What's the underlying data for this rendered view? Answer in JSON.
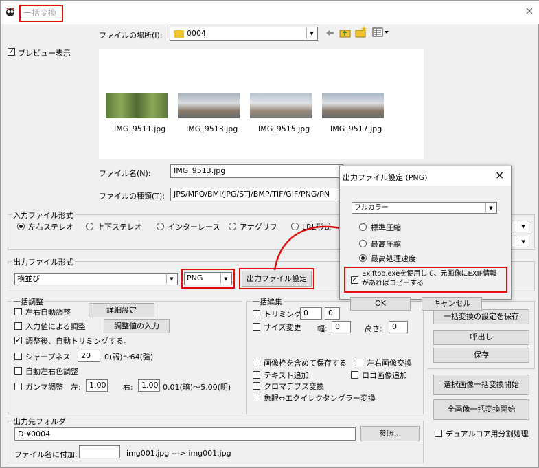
{
  "window": {
    "title": "一括変換",
    "close": "×"
  },
  "location": {
    "label": "ファイルの場所(I):",
    "value": "0004"
  },
  "preview_checkbox": {
    "label": "プレビュー表示",
    "mark": "✓"
  },
  "thumbnails": [
    {
      "name": "IMG_9511.jpg"
    },
    {
      "name": "IMG_9513.jpg"
    },
    {
      "name": "IMG_9515.jpg"
    },
    {
      "name": "IMG_9517.jpg"
    }
  ],
  "filename": {
    "label": "ファイル名(N):",
    "value": "IMG_9513.jpg"
  },
  "filetype": {
    "label": "ファイルの種類(T):",
    "value": "JPS/MPO/BMI/JPG/STJ/BMP/TIF/GIF/PNG/PN"
  },
  "input_format": {
    "title": "入力ファイル形式",
    "options": [
      "左右ステレオ",
      "上下ステレオ",
      "インターレース",
      "アナグリフ",
      "LRL形式"
    ],
    "selected": 0
  },
  "output_format": {
    "title": "出力ファイル形式",
    "layout_value": "横並び",
    "type_value": "PNG",
    "settings_button": "出力ファイル設定"
  },
  "batch_adjust": {
    "title": "一括調整",
    "auto_lr": "左右自動調整",
    "detail_button": "詳細設定",
    "input_adjust": "入力値による調整",
    "input_button": "調整値の入力",
    "auto_trim": "調整後、自動トリミングする。",
    "sharpness": "シャープネス",
    "sharpness_value": "20",
    "sharpness_range": "0(弱)～64(強)",
    "auto_color": "自動左右色調整",
    "gamma": "ガンマ調整",
    "gamma_left_label": "左:",
    "gamma_left": "1.00",
    "gamma_right_label": "右:",
    "gamma_right": "1.00",
    "gamma_range": "0.01(暗)～5.00(明)"
  },
  "batch_edit": {
    "title": "一括編集",
    "trimming": "トリミング",
    "trim_v1": "0",
    "trim_v2": "0",
    "resize": "サイズ変更",
    "width_label": "幅:",
    "width_value": "0",
    "height_label": "高さ:",
    "height_value": "0",
    "save_with_frame": "画像枠を含めて保存する",
    "lr_swap": "左右画像交換",
    "text_add": "テキスト追加",
    "logo_add": "ロゴ画像追加",
    "chroma": "クロマデプス変換",
    "fisheye": "魚眼⇔エクイレクタングラー変換"
  },
  "side_buttons": {
    "save_settings": "一括変換の設定を保存",
    "load": "呼出し",
    "save": "保存",
    "start_selected": "選択画像一括変換開始",
    "start_all": "全画像一括変換開始",
    "dual_core": "デュアルコア用分割処理"
  },
  "output_folder": {
    "title": "出力先フォルダ",
    "path": "D:¥0004",
    "browse": "参照...",
    "suffix_label": "ファイル名に付加:",
    "example": "img001.jpg ---> img001.jpg"
  },
  "dialog": {
    "title": "出力ファイル設定 (PNG)",
    "close": "×",
    "color_value": "フルカラー",
    "options": [
      "標準圧縮",
      "最高圧縮",
      "最高処理速度"
    ],
    "selected": 2,
    "exif_label": "Exiftoo.exeを使用して、元画像にEXIF情報があればコピーする",
    "ok": "OK",
    "cancel": "キャンセル"
  },
  "colors": {
    "accent_red": "#e01010",
    "folder": "#f4c430"
  }
}
